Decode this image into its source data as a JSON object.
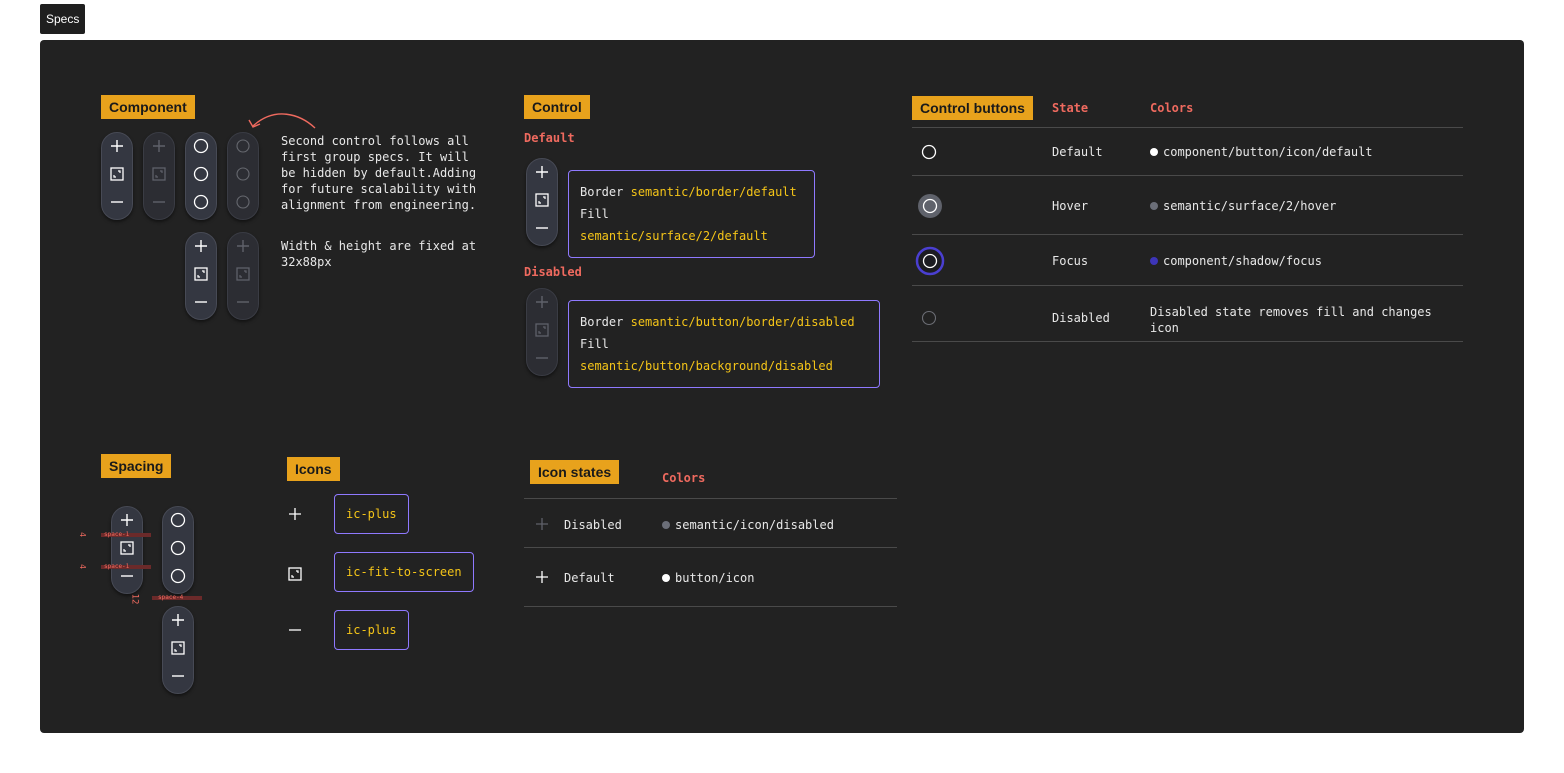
{
  "page_tag": "Specs",
  "colors": {
    "accent_tag": "#e8a21c",
    "heading_red": "#ef6a5f",
    "token_yellow": "#f5c518",
    "outline_purple": "#8f79ff",
    "frame_bg": "#222222",
    "focus_ring": "#4a3fd1"
  },
  "component": {
    "title": "Component",
    "note_1": "Second control follows all first group specs. It will be hidden by default.Adding for future scalability with alignment from engineering.",
    "note_2": "Width & height are fixed at 32x88px"
  },
  "control": {
    "title": "Control",
    "default_heading": "Default",
    "disabled_heading": "Disabled",
    "default_spec": {
      "border_label": "Border",
      "border_token": "semantic/border/default",
      "fill_label": "Fill",
      "fill_token": "semantic/surface/2/default"
    },
    "disabled_spec": {
      "border_label": "Border",
      "border_token": "semantic/button/border/disabled",
      "fill_label": "Fill",
      "fill_token": "semantic/button/background/disabled"
    }
  },
  "control_buttons": {
    "title": "Control buttons",
    "col_state": "State",
    "col_colors": "Colors",
    "rows": [
      {
        "state": "Default",
        "color_token": "component/button/icon/default",
        "dot_color": "#ffffff"
      },
      {
        "state": "Hover",
        "color_token": "semantic/surface/2/hover",
        "dot_color": "#6b6e78"
      },
      {
        "state": "Focus",
        "color_token": "component/shadow/focus",
        "dot_color": "#3d35b8"
      },
      {
        "state": "Disabled",
        "color_token": "Disabled state removes fill and changes icon"
      }
    ]
  },
  "spacing": {
    "title": "Spacing",
    "gap_small_1": "4",
    "gap_small_2": "4",
    "gap_large": "12",
    "marker_1": "space-1",
    "marker_2": "space-1",
    "marker_3": "space-4"
  },
  "icons": {
    "title": "Icons",
    "items": [
      {
        "icon": "plus-icon",
        "name": "ic-plus"
      },
      {
        "icon": "fit-to-screen-icon",
        "name": "ic-fit-to-screen"
      },
      {
        "icon": "minus-icon",
        "name": "ic-plus"
      }
    ]
  },
  "icon_states": {
    "title": "Icon states",
    "col_colors": "Colors",
    "rows": [
      {
        "state": "Disabled",
        "color_token": "semantic/icon/disabled",
        "dot_color": "#6b6e78"
      },
      {
        "state": "Default",
        "color_token": "button/icon",
        "dot_color": "#ffffff"
      }
    ]
  }
}
